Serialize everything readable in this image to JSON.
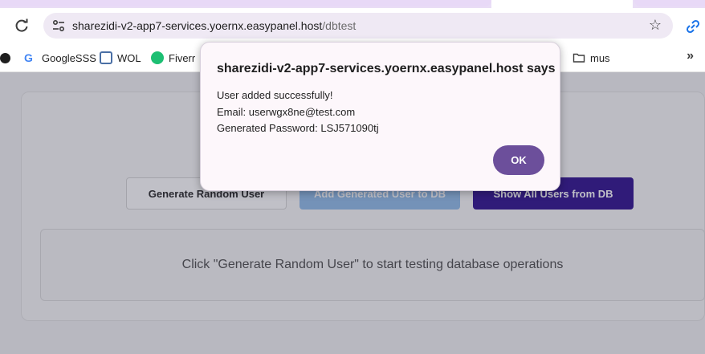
{
  "browser": {
    "url_host": "sharezidi-v2-app7-services.yoernx.easypanel.host",
    "url_path": "/dbtest",
    "icons": [
      "reload-icon",
      "site-info-icon",
      "star-icon",
      "link-icon",
      "chevron-double-right-icon"
    ]
  },
  "bookmarks": [
    {
      "label": "",
      "icon": "globe-icon"
    },
    {
      "label": "GoogleSSS",
      "icon": "google-icon"
    },
    {
      "label": "WOL",
      "icon": "wol-icon"
    },
    {
      "label": "Fiverr",
      "icon": "fiverr-icon"
    },
    {
      "label": "mus",
      "icon": "folder-icon"
    }
  ],
  "page": {
    "buttons": {
      "generate": "Generate Random User",
      "add": "Add Generated User to DB",
      "show": "Show All Users from DB"
    },
    "output_text": "Click \"Generate Random User\" to start testing database operations"
  },
  "dialog": {
    "title": "sharezidi-v2-app7-services.yoernx.easypanel.host says",
    "line1": "User added successfully!",
    "line2": "Email: userwgx8ne@test.com",
    "line3": "Generated Password: LSJ571090tj",
    "ok_label": "OK"
  },
  "colors": {
    "accent_button": "#6c4f9b",
    "show_button": "#2b0d8c",
    "add_button": "#8fbbe9"
  }
}
